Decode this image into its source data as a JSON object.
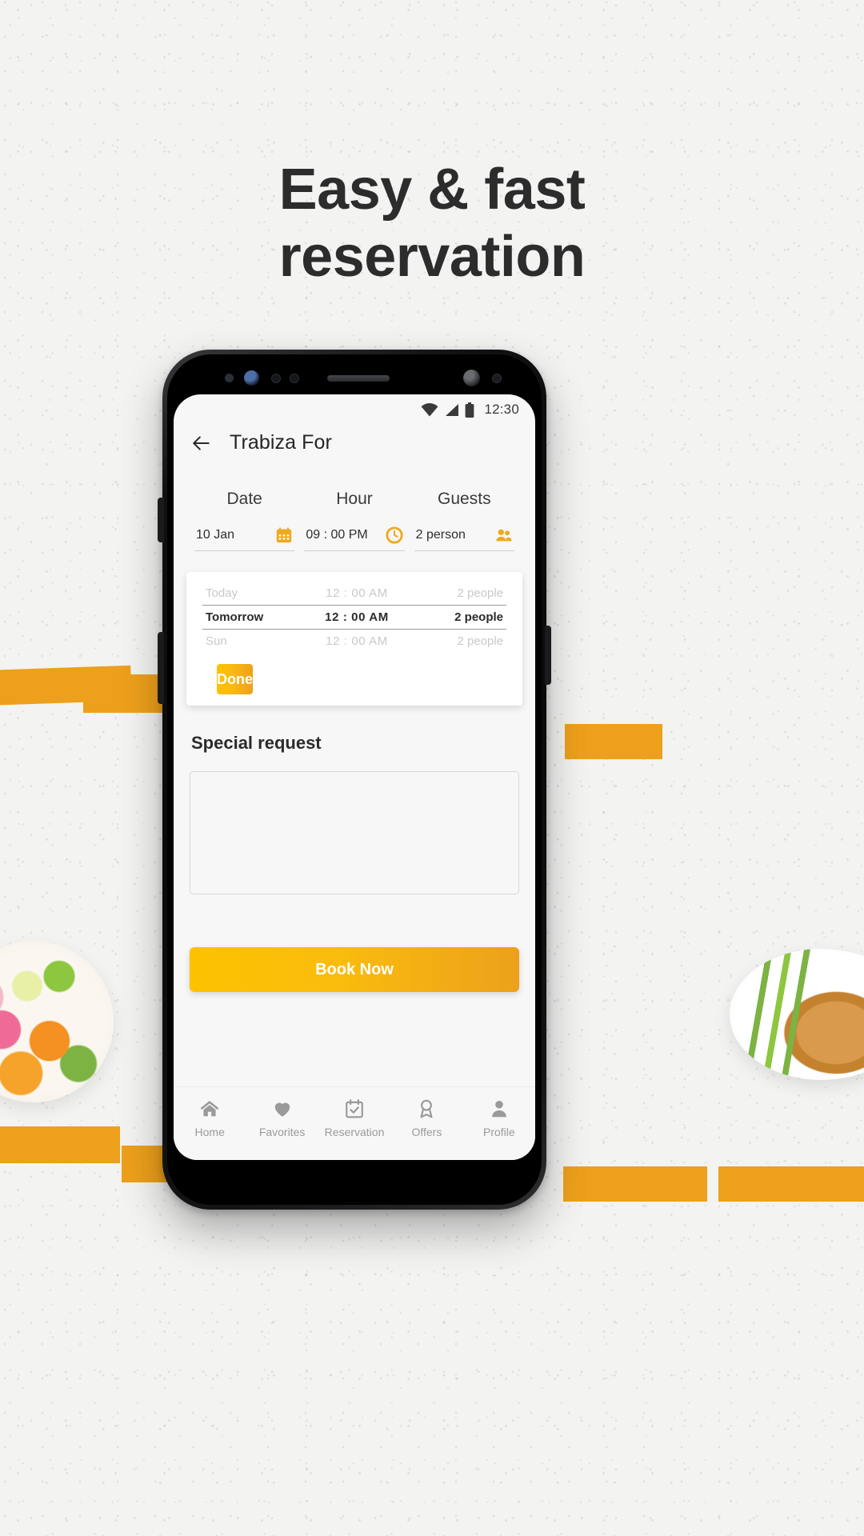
{
  "headline": {
    "line1": "Easy & fast",
    "line2": "reservation"
  },
  "colors": {
    "accent_yellow": "#fcc200",
    "accent_orange": "#eda01b",
    "background": "#f3f3f2",
    "screen_background": "#f7f7f7",
    "text_primary": "#2b2b2b",
    "text_muted": "#9a9a9a"
  },
  "statusbar": {
    "time": "12:30",
    "icons": [
      "wifi-icon",
      "signal-icon",
      "battery-icon"
    ]
  },
  "appbar": {
    "back_icon": "back-arrow-icon",
    "title": "Trabiza For"
  },
  "selectors": [
    {
      "label": "Date",
      "value": "10 Jan",
      "icon": "calendar-icon"
    },
    {
      "label": "Hour",
      "value": "09 : 00 PM",
      "icon": "clock-icon"
    },
    {
      "label": "Guests",
      "value": "2 person",
      "icon": "people-icon"
    }
  ],
  "picker": {
    "rows": [
      {
        "day": "Today",
        "time": "12 : 00 AM",
        "count": "2 people",
        "selected": false
      },
      {
        "day": "Tomorrow",
        "time": "12 : 00 AM",
        "count": "2 people",
        "selected": true
      },
      {
        "day": "Sun",
        "time": "12 : 00 AM",
        "count": "2 people",
        "selected": false
      }
    ],
    "done_label": "Done"
  },
  "special_request": {
    "title": "Special request",
    "value": "",
    "placeholder": ""
  },
  "book_now_label": "Book Now",
  "bottom_nav": [
    {
      "label": "Home",
      "icon": "home-icon"
    },
    {
      "label": "Favorites",
      "icon": "heart-icon"
    },
    {
      "label": "Reservation",
      "icon": "calendar-check-icon"
    },
    {
      "label": "Offers",
      "icon": "award-icon"
    },
    {
      "label": "Profile",
      "icon": "person-icon"
    }
  ]
}
